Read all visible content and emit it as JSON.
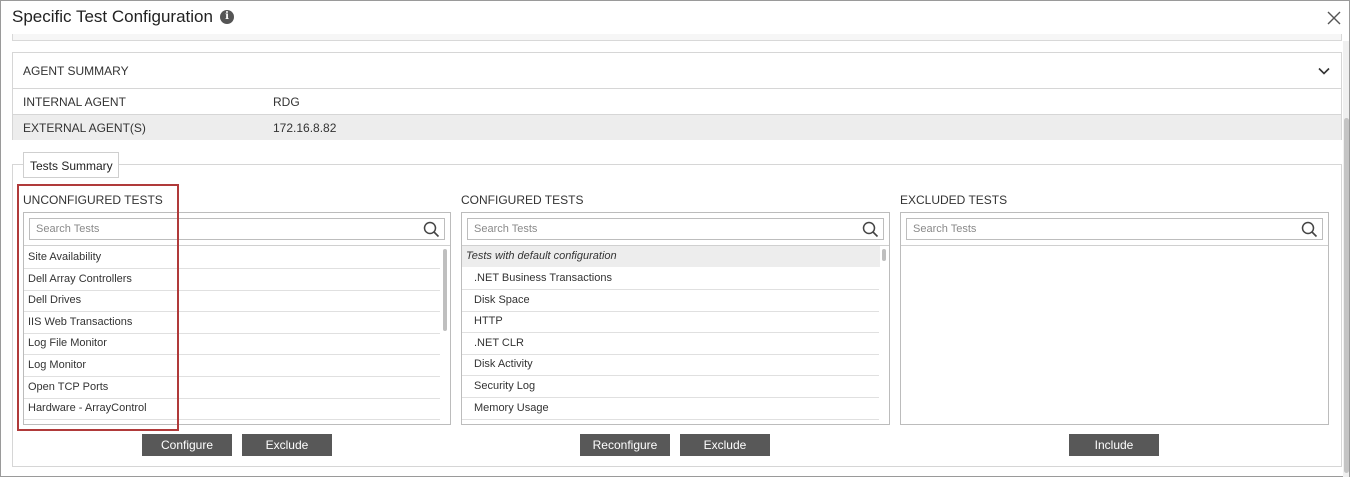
{
  "dialog": {
    "title": "Specific Test Configuration",
    "info_glyph": "i",
    "close_icon": "close-icon"
  },
  "agent_summary": {
    "header": "AGENT SUMMARY",
    "rows": [
      {
        "key": "INTERNAL AGENT",
        "value": "RDG"
      },
      {
        "key": "EXTERNAL AGENT(S)",
        "value": "172.16.8.82"
      }
    ]
  },
  "tests_summary": {
    "tab_label": "Tests Summary",
    "unconfigured": {
      "title": "UNCONFIGURED TESTS",
      "search_placeholder": "Search Tests",
      "items": [
        "Site Availability",
        "Dell Array Controllers",
        "Dell Drives",
        "IIS Web Transactions",
        "Log File Monitor",
        "Log Monitor",
        "Open TCP Ports",
        "Hardware - ArrayControl"
      ]
    },
    "configured": {
      "title": "CONFIGURED TESTS",
      "search_placeholder": "Search Tests",
      "group_label": "Tests with default configuration",
      "items": [
        ".NET Business Transactions",
        "Disk Space",
        "HTTP",
        ".NET CLR",
        "Disk Activity",
        "Security Log",
        "Memory Usage"
      ]
    },
    "excluded": {
      "title": "EXCLUDED TESTS",
      "search_placeholder": "Search Tests",
      "items": []
    }
  },
  "buttons": {
    "configure": "Configure",
    "exclude_unconfigured": "Exclude",
    "reconfigure": "Reconfigure",
    "exclude_configured": "Exclude",
    "include": "Include"
  },
  "colors": {
    "button_bg": "#585858",
    "highlight_border": "#b03a3a",
    "row_alt": "#ededed"
  }
}
